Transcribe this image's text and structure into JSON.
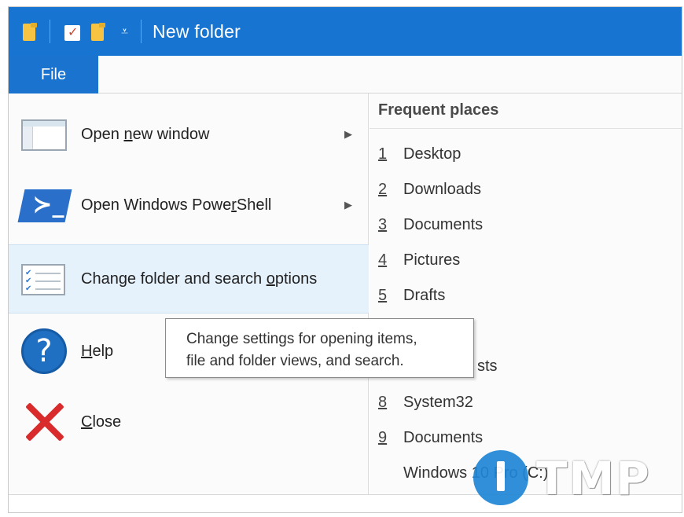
{
  "window": {
    "title": "New folder"
  },
  "ribbon": {
    "file_tab": "File"
  },
  "menu": {
    "items": [
      {
        "label_pre": "Open ",
        "label_key": "n",
        "label_post": "ew window",
        "has_submenu": true
      },
      {
        "label_pre": "Open Windows Powe",
        "label_key": "r",
        "label_post": "Shell",
        "has_submenu": true
      },
      {
        "label_pre": "Change folder and search ",
        "label_key": "o",
        "label_post": "ptions",
        "has_submenu": false,
        "highlighted": true
      },
      {
        "label_pre": "",
        "label_key": "H",
        "label_post": "elp",
        "has_submenu": false
      },
      {
        "label_pre": "",
        "label_key": "C",
        "label_post": "lose",
        "has_submenu": false
      }
    ],
    "submenu_arrow": "▶"
  },
  "tooltip": {
    "line1": "Change settings for opening items,",
    "line2": "file and folder views, and search."
  },
  "frequent_places": {
    "heading": "Frequent places",
    "items": [
      {
        "num": "1",
        "name": "Desktop"
      },
      {
        "num": "2",
        "name": "Downloads"
      },
      {
        "num": "3",
        "name": "Documents"
      },
      {
        "num": "4",
        "name": "Pictures"
      },
      {
        "num": "5",
        "name": "Drafts"
      },
      {
        "num": "",
        "name": "sts"
      },
      {
        "num": "8",
        "name": "System32"
      },
      {
        "num": "9",
        "name": "Documents"
      },
      {
        "num": "",
        "name": "Windows 10 Pro (C:)"
      }
    ]
  },
  "watermark": {
    "text": "TMP"
  }
}
